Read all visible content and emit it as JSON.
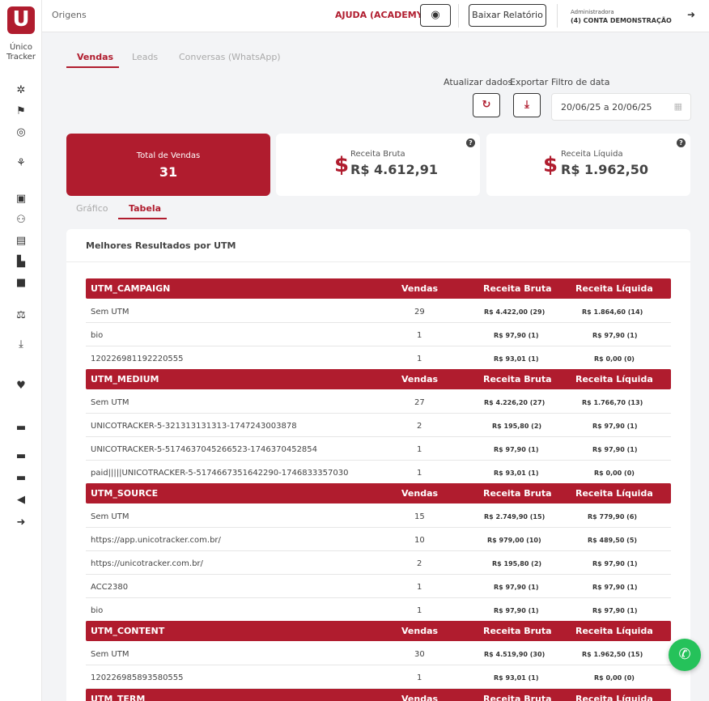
{
  "brand": {
    "logo_letter": "U",
    "name_line1": "Único",
    "name_line2": "Tracker",
    "accent": "#b01c2e"
  },
  "header": {
    "breadcrumb": "Origens",
    "help_link": "AJUDA (ACADEMY)",
    "report_button": "Baixar Relatório",
    "admin_role": "Administradora",
    "admin_account": "(4) CONTA DEMONSTRAÇÃO"
  },
  "tabs": [
    {
      "label": "Vendas",
      "active": true
    },
    {
      "label": "Leads",
      "active": false
    },
    {
      "label": "Conversas (WhatsApp)",
      "active": false
    }
  ],
  "controls": {
    "refresh_label": "Atualizar dados",
    "export_label": "Exportar",
    "date_label": "Filtro de data",
    "date_value": "20/06/25 a 20/06/25"
  },
  "stats": {
    "total_label": "Total de Vendas",
    "total_value": "31",
    "gross_label": "Receita Bruta",
    "gross_value": "R$ 4.612,91",
    "net_label": "Receita Líquida",
    "net_value": "R$ 1.962,50"
  },
  "subtabs": [
    {
      "label": "Gráfico",
      "active": false
    },
    {
      "label": "Tabela",
      "active": true
    }
  ],
  "panel_title": "Melhores Resultados por UTM",
  "columns": {
    "sales": "Vendas",
    "gross": "Receita Bruta",
    "net": "Receita Líquida"
  },
  "tables": [
    {
      "name": "UTM_CAMPAIGN",
      "rows": [
        [
          "Sem UTM",
          "29",
          "R$ 4.422,00 (29)",
          "R$ 1.864,60 (14)"
        ],
        [
          "bio",
          "1",
          "R$ 97,90 (1)",
          "R$ 97,90 (1)"
        ],
        [
          "120226981192220555",
          "1",
          "R$ 93,01 (1)",
          "R$ 0,00 (0)"
        ]
      ]
    },
    {
      "name": "UTM_MEDIUM",
      "rows": [
        [
          "Sem UTM",
          "27",
          "R$ 4.226,20 (27)",
          "R$ 1.766,70 (13)"
        ],
        [
          "UNICOTRACKER-5-321313131313-1747243003878",
          "2",
          "R$ 195,80 (2)",
          "R$ 97,90 (1)"
        ],
        [
          "UNICOTRACKER-5-5174637045266523-1746370452854",
          "1",
          "R$ 97,90 (1)",
          "R$ 97,90 (1)"
        ],
        [
          "paid|||||UNICOTRACKER-5-5174667351642290-1746833357030",
          "1",
          "R$ 93,01 (1)",
          "R$ 0,00 (0)"
        ]
      ]
    },
    {
      "name": "UTM_SOURCE",
      "rows": [
        [
          "Sem UTM",
          "15",
          "R$ 2.749,90 (15)",
          "R$ 779,90 (6)"
        ],
        [
          "https://app.unicotracker.com.br/",
          "10",
          "R$ 979,00 (10)",
          "R$ 489,50 (5)"
        ],
        [
          "https://unicotracker.com.br/",
          "2",
          "R$ 195,80 (2)",
          "R$ 97,90 (1)"
        ],
        [
          "ACC2380",
          "1",
          "R$ 97,90 (1)",
          "R$ 97,90 (1)"
        ],
        [
          "bio",
          "1",
          "R$ 97,90 (1)",
          "R$ 97,90 (1)"
        ]
      ]
    },
    {
      "name": "UTM_CONTENT",
      "rows": [
        [
          "Sem UTM",
          "30",
          "R$ 4.519,90 (30)",
          "R$ 1.962,50 (15)"
        ],
        [
          "120226985893580555",
          "1",
          "R$ 93,01 (1)",
          "R$ 0,00 (0)"
        ]
      ]
    },
    {
      "name": "UTM_TERM",
      "rows": []
    }
  ]
}
